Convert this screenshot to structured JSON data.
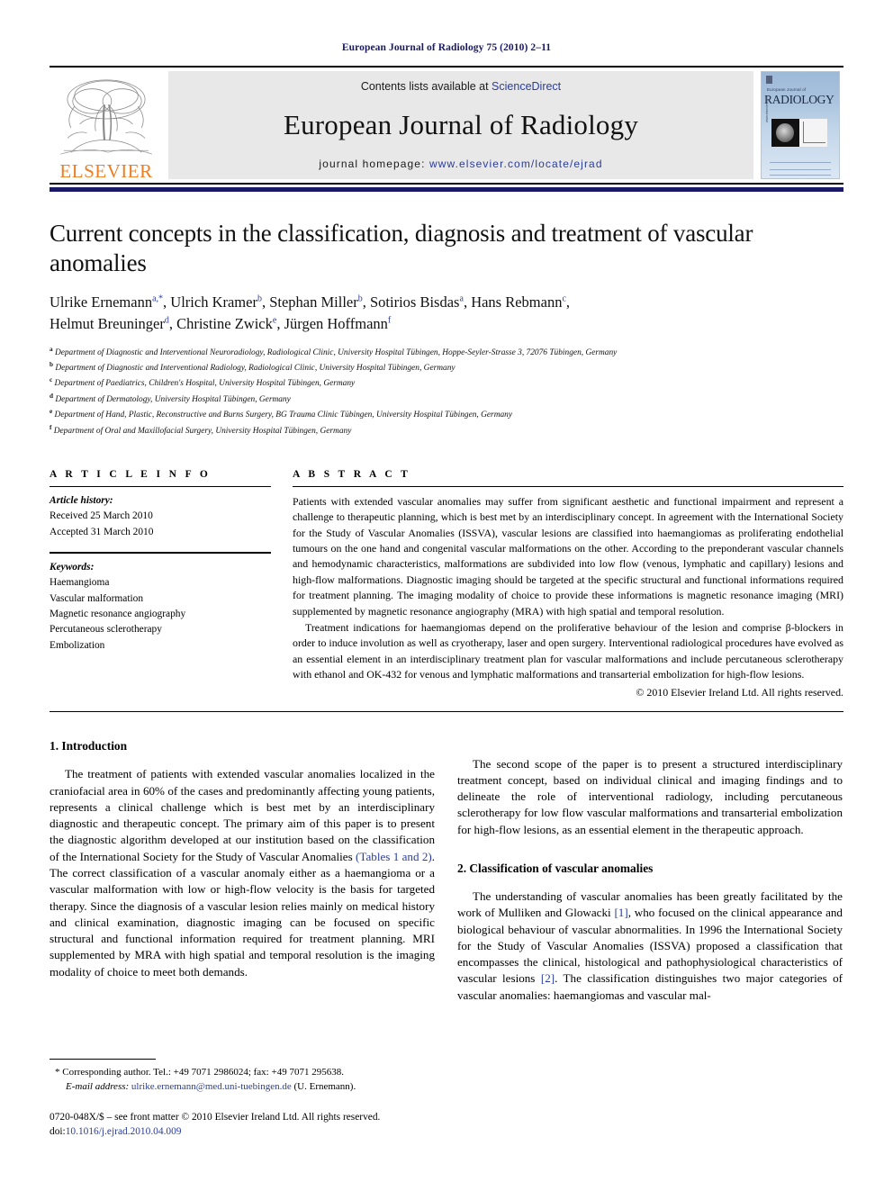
{
  "running_head": "European Journal of Radiology 75 (2010) 2–11",
  "masthead": {
    "publisher_logo_text": "ELSEVIER",
    "contents_prefix": "Contents lists available at ",
    "contents_link": "ScienceDirect",
    "journal_name": "European Journal of Radiology",
    "homepage_prefix": "journal homepage:",
    "homepage_url": "www.elsevier.com/locate/ejrad",
    "cover": {
      "line1": "European Journal of",
      "line2": "RADIOLOGY"
    },
    "link_color": "#2a3d9c",
    "logo_color": "#ef7d21"
  },
  "article": {
    "title": "Current concepts in the classification, diagnosis and treatment of vascular anomalies",
    "authors": [
      {
        "name": "Ulrike Ernemann",
        "marks": "a,*"
      },
      {
        "name": "Ulrich Kramer",
        "marks": "b"
      },
      {
        "name": "Stephan Miller",
        "marks": "b"
      },
      {
        "name": "Sotirios Bisdas",
        "marks": "a"
      },
      {
        "name": "Hans Rebmann",
        "marks": "c"
      },
      {
        "name": "Helmut Breuninger",
        "marks": "d"
      },
      {
        "name": "Christine Zwick",
        "marks": "e"
      },
      {
        "name": "Jürgen Hoffmann",
        "marks": "f"
      }
    ],
    "affiliations": [
      {
        "label": "a",
        "text": "Department of Diagnostic and Interventional Neuroradiology, Radiological Clinic, University Hospital Tübingen, Hoppe-Seyler-Strasse 3, 72076 Tübingen, Germany"
      },
      {
        "label": "b",
        "text": "Department of Diagnostic and Interventional Radiology, Radiological Clinic, University Hospital Tübingen, Germany"
      },
      {
        "label": "c",
        "text": "Department of Paediatrics, Children's Hospital, University Hospital Tübingen, Germany"
      },
      {
        "label": "d",
        "text": "Department of Dermatology, University Hospital Tübingen, Germany"
      },
      {
        "label": "e",
        "text": "Department of Hand, Plastic, Reconstructive and Burns Surgery, BG Trauma Clinic Tübingen, University Hospital Tübingen, Germany"
      },
      {
        "label": "f",
        "text": "Department of Oral and Maxillofacial Surgery, University Hospital Tübingen, Germany"
      }
    ]
  },
  "article_info": {
    "heading": "A R T I C L E   I N F O",
    "history_label": "Article history:",
    "history": [
      "Received 25 March 2010",
      "Accepted 31 March 2010"
    ],
    "keywords_label": "Keywords:",
    "keywords": [
      "Haemangioma",
      "Vascular malformation",
      "Magnetic resonance angiography",
      "Percutaneous sclerotherapy",
      "Embolization"
    ]
  },
  "abstract": {
    "heading": "A B S T R A C T",
    "paragraphs": [
      "Patients with extended vascular anomalies may suffer from significant aesthetic and functional impairment and represent a challenge to therapeutic planning, which is best met by an interdisciplinary concept. In agreement with the International Society for the Study of Vascular Anomalies (ISSVA), vascular lesions are classified into haemangiomas as proliferating endothelial tumours on the one hand and congenital vascular malformations on the other. According to the preponderant vascular channels and hemodynamic characteristics, malformations are subdivided into low flow (venous, lymphatic and capillary) lesions and high-flow malformations. Diagnostic imaging should be targeted at the specific structural and functional informations required for treatment planning. The imaging modality of choice to provide these informations is magnetic resonance imaging (MRI) supplemented by magnetic resonance angiography (MRA) with high spatial and temporal resolution.",
      "Treatment indications for haemangiomas depend on the proliferative behaviour of the lesion and comprise β-blockers in order to induce involution as well as cryotherapy, laser and open surgery. Interventional radiological procedures have evolved as an essential element in an interdisciplinary treatment plan for vascular malformations and include percutaneous sclerotherapy with ethanol and OK-432 for venous and lymphatic malformations and transarterial embolization for high-flow lesions."
    ],
    "copyright": "© 2010 Elsevier Ireland Ltd. All rights reserved."
  },
  "body": {
    "section1_heading": "1. Introduction",
    "section1_p1_a": "The treatment of patients with extended vascular anomalies localized in the craniofacial area in 60% of the cases and predominantly affecting young patients, represents a clinical challenge which is best met by an interdisciplinary diagnostic and therapeutic concept. The primary aim of this paper is to present the diagnostic algorithm developed at our institution based on the classification of the International Society for the Study of Vascular Anomalies ",
    "section1_p1_link": "(Tables 1 and 2)",
    "section1_p1_b": ". The correct classification of a vascular anomaly either as a haemangioma or a vascular malformation with low or high-flow velocity is the basis for targeted therapy. Since the diagnosis of a vascular lesion relies mainly on medical history and clinical examination, diagnostic imaging can be focused on specific structural and functional information required for treatment planning. MRI supplemented by MRA with high spatial and temporal resolution is the imaging modality of choice to meet both demands.",
    "section1_p2": "The second scope of the paper is to present a structured interdisciplinary treatment concept, based on individual clinical and imaging findings and to delineate the role of interventional radiology, including percutaneous sclerotherapy for low flow vascular malformations and transarterial embolization for high-flow lesions, as an essential element in the therapeutic approach.",
    "section2_heading": "2. Classification of vascular anomalies",
    "section2_p1_a": "The understanding of vascular anomalies has been greatly facilitated by the work of Mulliken and Glowacki ",
    "section2_p1_ref1": "[1]",
    "section2_p1_b": ", who focused on the clinical appearance and biological behaviour of vascular abnormalities. In 1996 the International Society for the Study of Vascular Anomalies (ISSVA) proposed a classification that encompasses the clinical, histological and pathophysiological characteristics of vascular lesions ",
    "section2_p1_ref2": "[2]",
    "section2_p1_c": ". The classification distinguishes two major categories of vascular anomalies: haemangiomas and vascular mal-"
  },
  "footnote": {
    "corresponding_mark": "*",
    "corresponding_text": "Corresponding author. Tel.: +49 7071 2986024; fax: +49 7071 295638.",
    "email_label": "E-mail address:",
    "email": "ulrike.ernemann@med.uni-tuebingen.de",
    "email_suffix": "(U. Ernemann).",
    "issn_line": "0720-048X/$ – see front matter © 2010 Elsevier Ireland Ltd. All rights reserved.",
    "doi_prefix": "doi:",
    "doi": "10.1016/j.ejrad.2010.04.009"
  }
}
